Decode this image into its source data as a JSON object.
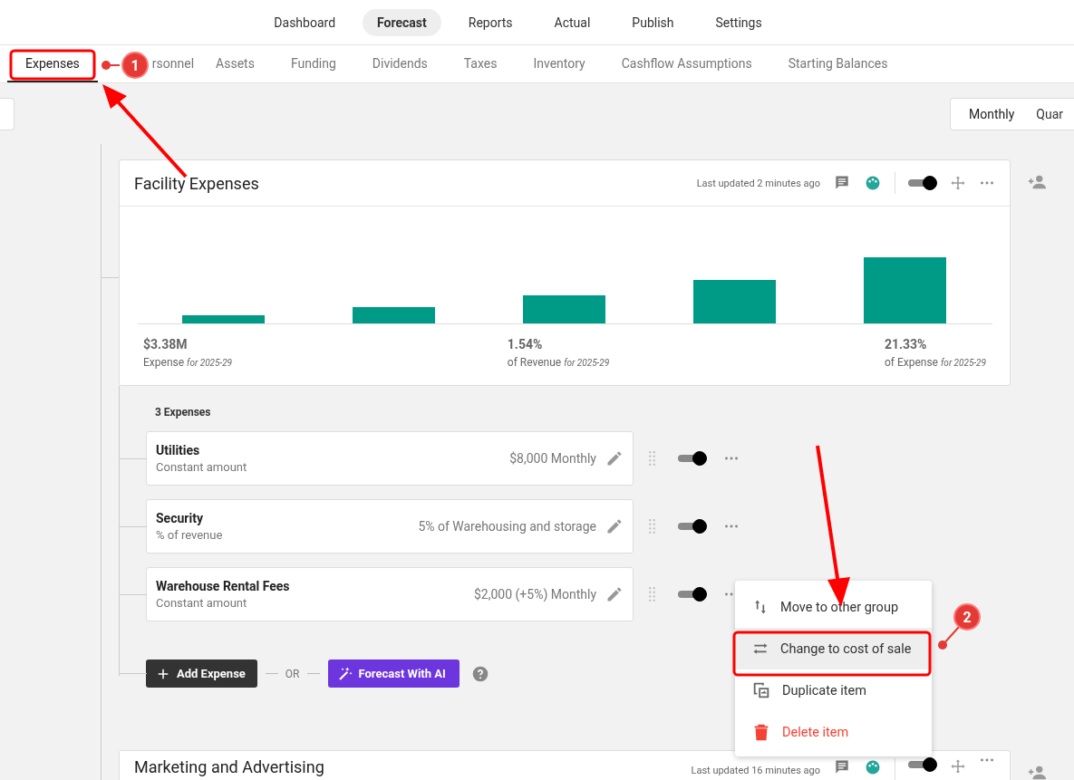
{
  "top_nav": [
    {
      "label": "Dashboard",
      "selected": false
    },
    {
      "label": "Forecast",
      "selected": true
    },
    {
      "label": "Reports",
      "selected": false
    },
    {
      "label": "Actual",
      "selected": false
    },
    {
      "label": "Publish",
      "selected": false
    },
    {
      "label": "Settings",
      "selected": false
    }
  ],
  "sub_tabs": [
    {
      "label": "Expenses",
      "selected": true
    },
    {
      "label": "rsonnel",
      "selected": false
    },
    {
      "label": "Assets",
      "selected": false
    },
    {
      "label": "Funding",
      "selected": false
    },
    {
      "label": "Dividends",
      "selected": false
    },
    {
      "label": "Taxes",
      "selected": false
    },
    {
      "label": "Inventory",
      "selected": false
    },
    {
      "label": "Cashflow Assumptions",
      "selected": false
    },
    {
      "label": "Starting Balances",
      "selected": false
    }
  ],
  "period_toggle": [
    {
      "label": "Monthly",
      "selected": true
    },
    {
      "label": "Quar",
      "selected": false
    }
  ],
  "groups": [
    {
      "title": "Facility Expenses",
      "updated": "Last updated 2 minutes ago",
      "on": true,
      "stats": [
        {
          "value": "$3.38M",
          "label": "Expense",
          "period": "for 2025-29"
        },
        {
          "value": "1.54%",
          "label": "of Revenue",
          "period": "for 2025-29"
        },
        {
          "value": "21.33%",
          "label": "of Expense",
          "period": "for 2025-29"
        }
      ],
      "count": "3 Expenses",
      "items": [
        {
          "name": "Utilities",
          "method": "Constant amount",
          "amount": "$8,000 Monthly",
          "on": true
        },
        {
          "name": "Security",
          "method": "% of revenue",
          "amount": "5% of Warehousing and storage",
          "on": true
        },
        {
          "name": "Warehouse Rental Fees",
          "method": "Constant amount",
          "amount": "$2,000 (+5%) Monthly",
          "on": true
        }
      ],
      "add_label": "Add Expense",
      "or_label": "OR",
      "ai_label": "Forecast With AI"
    },
    {
      "title": "Marketing and Advertising",
      "updated": "Last updated 16 minutes ago",
      "on": true
    }
  ],
  "context_menu": [
    {
      "label": "Move to other group",
      "kind": "move",
      "selected": false
    },
    {
      "label": "Change to cost of sale",
      "kind": "swap",
      "selected": true
    },
    {
      "label": "Duplicate item",
      "kind": "duplicate",
      "selected": false
    },
    {
      "label": "Delete item",
      "kind": "delete",
      "selected": false
    }
  ],
  "annotations": [
    {
      "kind": "callout",
      "number": "1"
    },
    {
      "kind": "callout",
      "number": "2"
    }
  ]
}
